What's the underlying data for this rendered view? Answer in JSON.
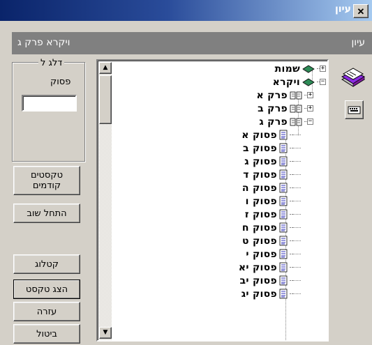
{
  "window": {
    "title": "עיון",
    "close_label": "✕"
  },
  "header": {
    "left_text": "ויקרא פרק ג",
    "right_text": "עיון"
  },
  "verse_group": {
    "legend": "דלג ל",
    "label": "פסוק",
    "value": ""
  },
  "buttons": {
    "previous_texts": "טקסטים\nקודמים",
    "search_again": "התחל שוב",
    "catalog": "קטלוג",
    "show_text": "הצג טקסט",
    "help": "עזרה",
    "cancel": "ביטול"
  },
  "tree": {
    "books": [
      {
        "label": "שמות",
        "expanded": false
      },
      {
        "label": "ויקרא",
        "expanded": true
      }
    ],
    "chapters": [
      {
        "label": "פרק א",
        "expanded": false
      },
      {
        "label": "פרק ב",
        "expanded": false
      },
      {
        "label": "פרק ג",
        "expanded": true
      }
    ],
    "verses": [
      "פסוק א",
      "פסוק ב",
      "פסוק ג",
      "פסוק ד",
      "פסוק ה",
      "פסוק ו",
      "פסוק ז",
      "פסוק ח",
      "פסוק ט",
      "פסוק י",
      "פסוק יא",
      "פסוק יב",
      "פסוק יג"
    ]
  },
  "icons": {
    "book_closed": "green-book-icon",
    "chapter": "open-book-icon",
    "verse": "page-icon",
    "big_tool": "books-stack-icon",
    "small_tool": "keyboard-icon"
  },
  "colors": {
    "accent": "#0a246a",
    "header_strip": "#808080",
    "tree_bg": "#ffffff"
  }
}
